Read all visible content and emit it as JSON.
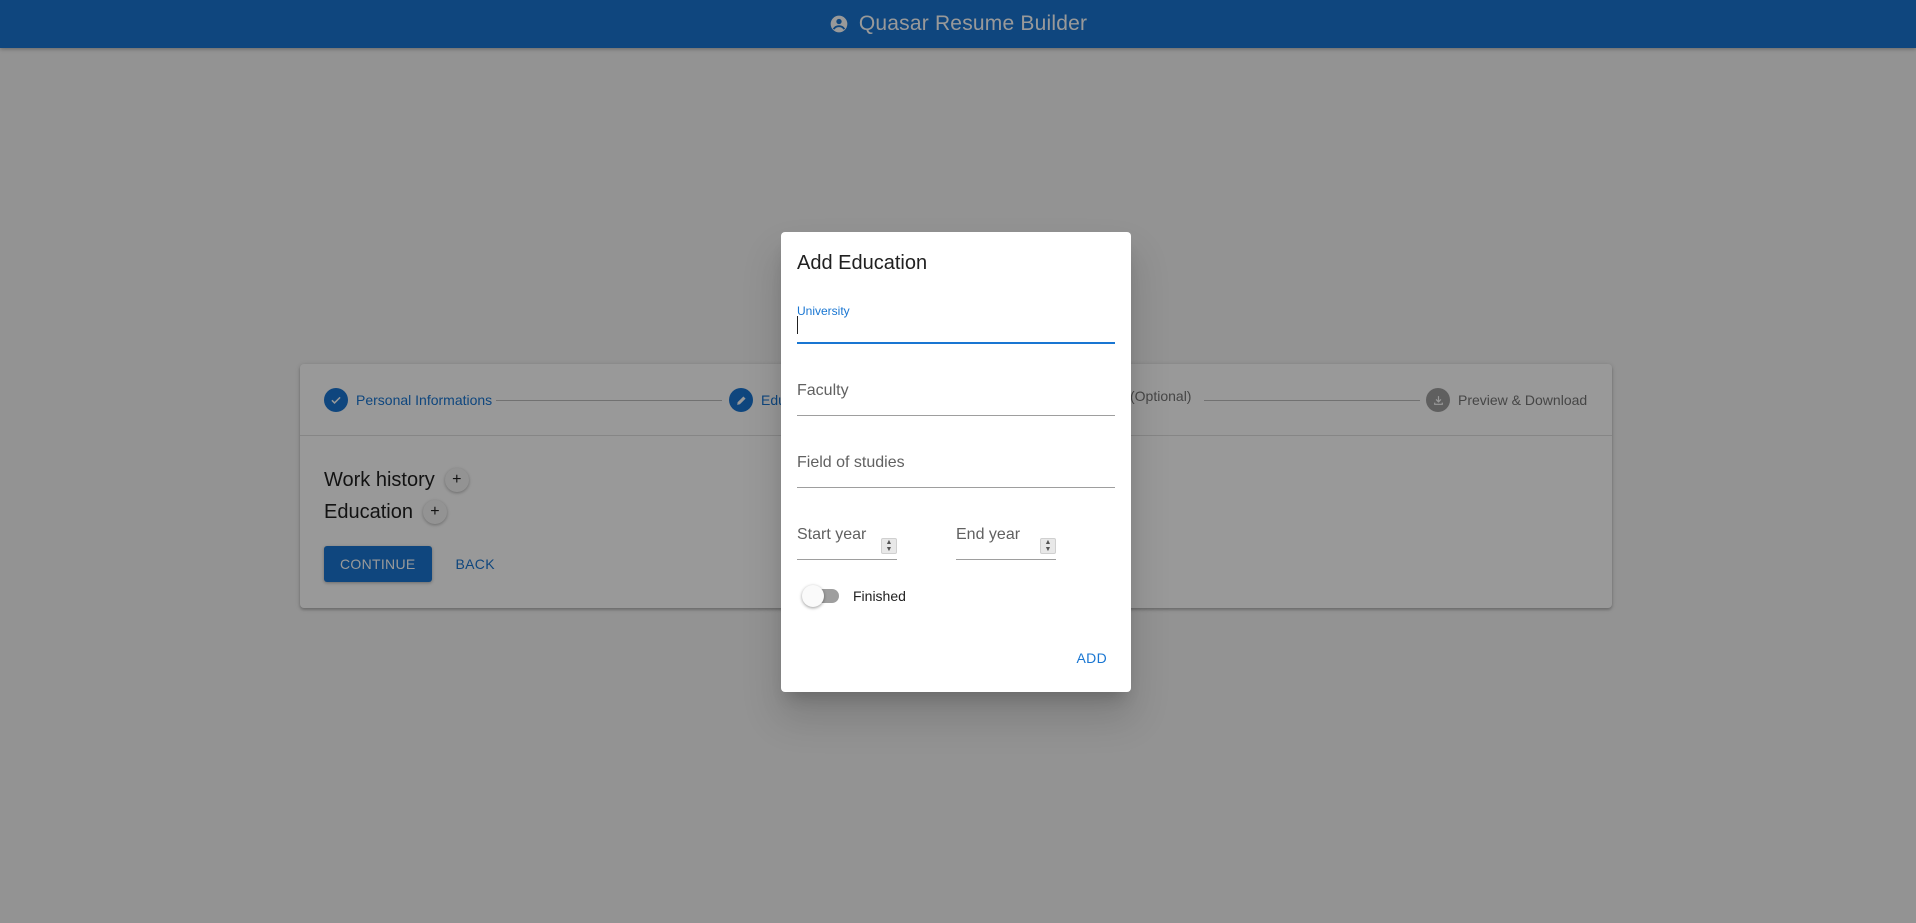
{
  "header": {
    "title": "Quasar Resume Builder",
    "icon": "account-circle-icon",
    "color": "#1976d2"
  },
  "stepper": {
    "steps": [
      {
        "label": "Personal Informations",
        "state": "done",
        "icon": "check-icon"
      },
      {
        "label": "Edu",
        "state": "active",
        "icon": "pencil-icon"
      },
      {
        "label": "(Optional)",
        "state": "pending",
        "icon": ""
      },
      {
        "label": "Preview & Download",
        "state": "pending",
        "icon": "download-icon"
      }
    ]
  },
  "content": {
    "work_history": "Work history",
    "education": "Education",
    "add_symbol": "+",
    "continue_label": "CONTINUE",
    "back_label": "BACK"
  },
  "dialog": {
    "title": "Add Education",
    "university_label": "University",
    "university_value": "",
    "faculty_label": "Faculty",
    "field_of_studies_label": "Field of studies",
    "start_year_label": "Start year",
    "end_year_label": "End year",
    "finished_label": "Finished",
    "finished_checked": false,
    "add_label": "ADD"
  },
  "colors": {
    "primary": "#1976d2",
    "backdrop": "rgba(0,0,0,0.4)"
  }
}
